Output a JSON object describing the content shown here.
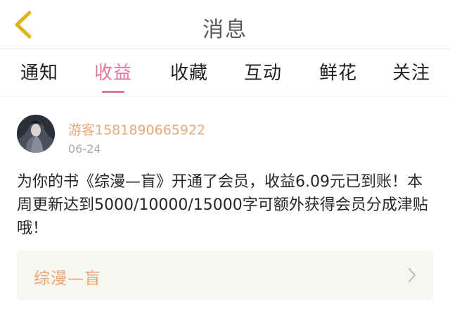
{
  "header": {
    "title": "消息",
    "back_icon": "chevron-left-icon",
    "accent_color": "#e2b21a"
  },
  "tabs": [
    {
      "label": "通知",
      "active": false
    },
    {
      "label": "收益",
      "active": true
    },
    {
      "label": "收藏",
      "active": false
    },
    {
      "label": "互动",
      "active": false
    },
    {
      "label": "鲜花",
      "active": false
    },
    {
      "label": "关注",
      "active": false
    }
  ],
  "message": {
    "username": "游客1581890665922",
    "date": "06-24",
    "content": "为你的书《综漫—盲》开通了会员，收益6.09元已到账！本周更新达到5000/10000/15000字可额外获得会员分成津贴哦！",
    "book_title": "综漫—盲",
    "chevron_icon": "chevron-right-icon"
  },
  "colors": {
    "active_tab": "#e0779a",
    "username": "#e9a77a",
    "card_bg": "#f7f6f1"
  }
}
